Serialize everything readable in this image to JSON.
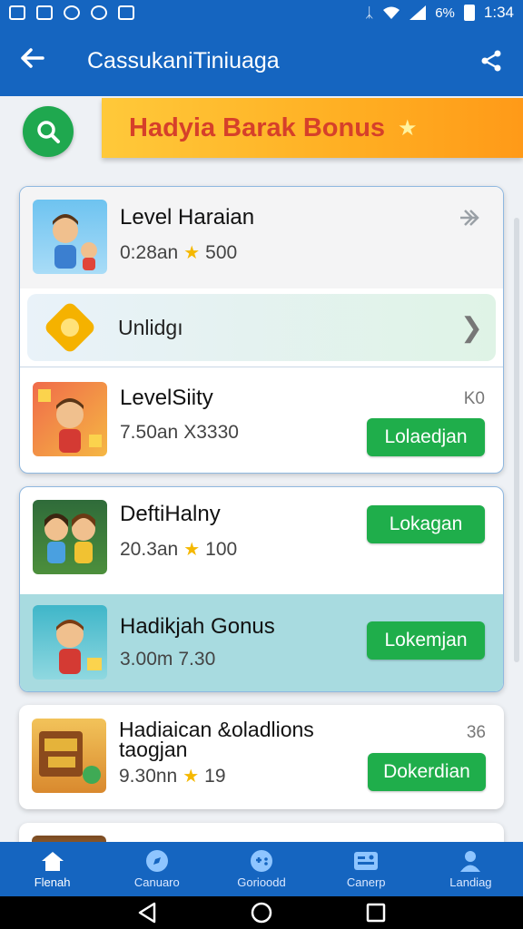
{
  "status_bar": {
    "battery_text": "6%",
    "time": "1:34"
  },
  "app_bar": {
    "title": "CassukaniTiniuaga"
  },
  "banner": {
    "title": "Hadyia Barak Bonus"
  },
  "items": [
    {
      "title": "Level Haraian",
      "time": "0:28an",
      "points": "500"
    },
    {
      "title": "LevelSiity",
      "time": "7.50an",
      "extra": "X3330",
      "side": "K0",
      "button": "Lolaedjan"
    },
    {
      "title": "DeftiHalny",
      "time": "20.3an",
      "points": "100",
      "button": "Lokagan"
    },
    {
      "title": "Hadikjah Gonus",
      "time": "3.00m",
      "extra": "7.30",
      "button": "Lokemjan"
    },
    {
      "title": "Hadiaican &oladlions taogjan",
      "time": "9.30nn",
      "points": "19",
      "side": "36",
      "button": "Dokerdian"
    }
  ],
  "unlock": {
    "label": "Unlidgı"
  },
  "bottom_nav": [
    {
      "label": "Flenah",
      "icon": "home-icon"
    },
    {
      "label": "Canuaro",
      "icon": "compass-icon"
    },
    {
      "label": "Gorioodd",
      "icon": "gamepad-icon"
    },
    {
      "label": "Canerp",
      "icon": "calendar-icon"
    },
    {
      "label": "Landiag",
      "icon": "person-icon"
    }
  ],
  "colors": {
    "primary": "#1565c0",
    "accent_green": "#1fae4b",
    "banner_orange": "#ffae22",
    "banner_text": "#d6402a"
  }
}
